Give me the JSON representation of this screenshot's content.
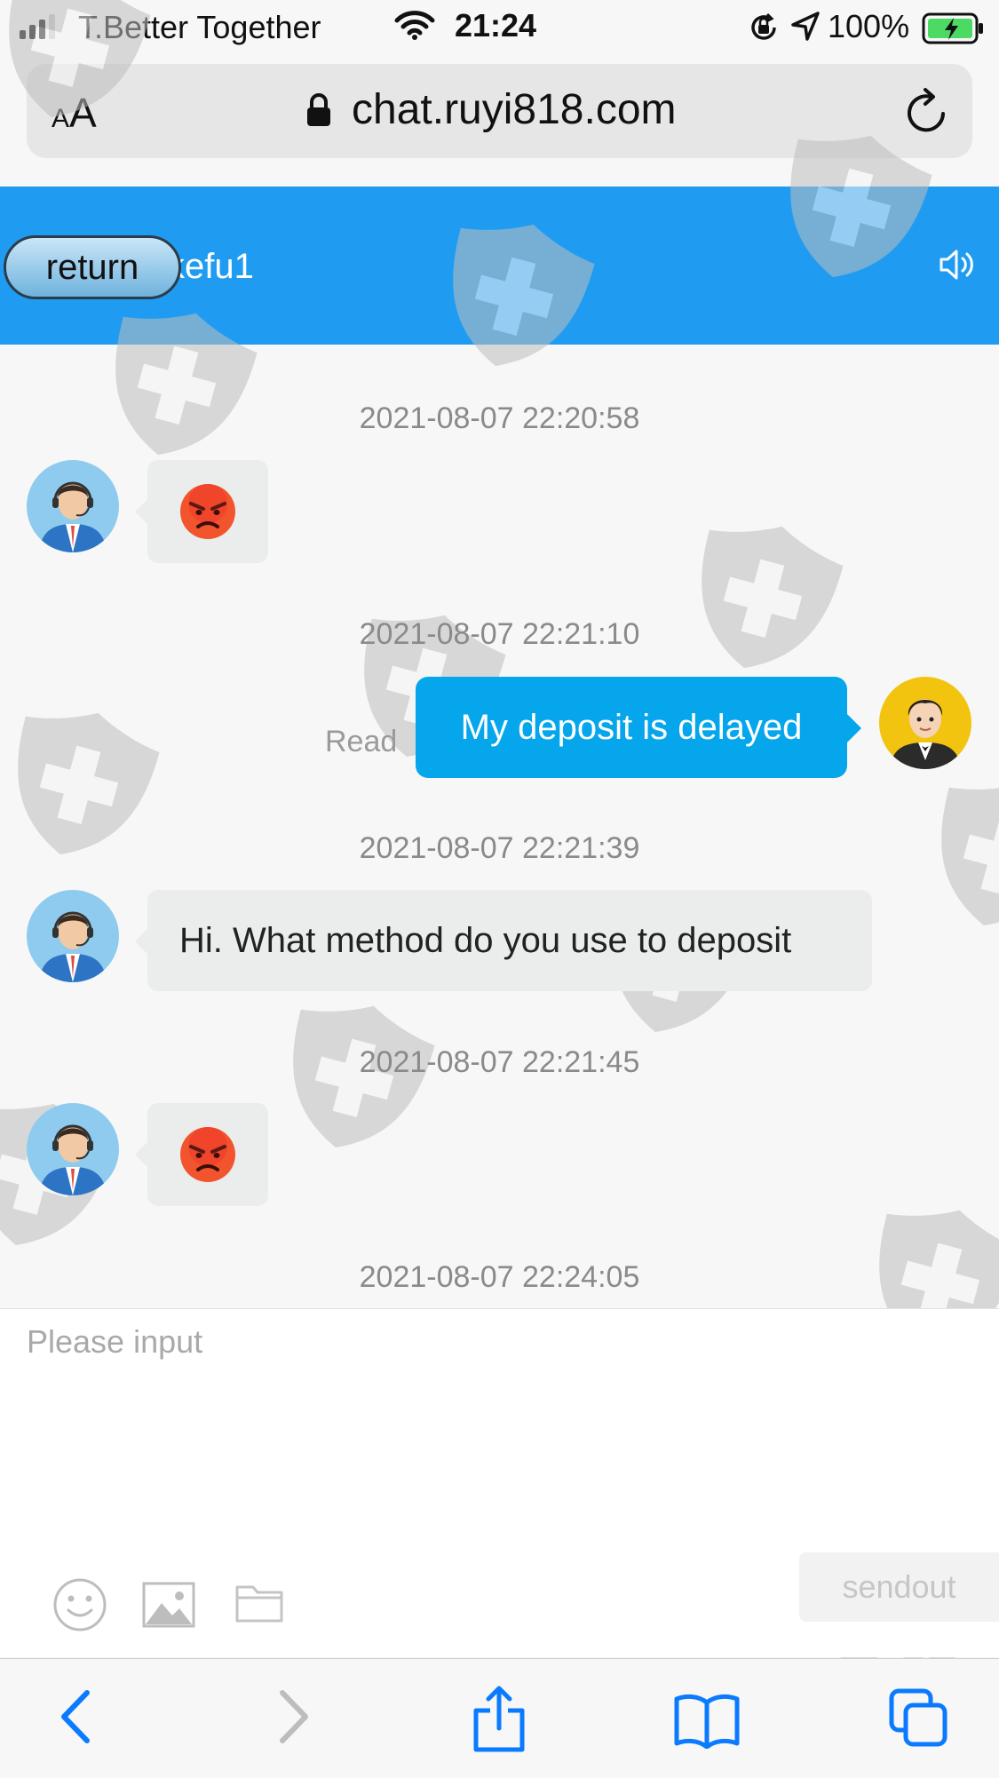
{
  "status_bar": {
    "carrier": "T.Better Together",
    "time": "21:24",
    "battery": "100%"
  },
  "browser": {
    "text_size_label": "AA",
    "url": "chat.ruyi818.com"
  },
  "header": {
    "return_label": "return",
    "title": "kefu1",
    "accent_color": "#1f9cf2"
  },
  "messages": [
    {
      "time": "2021-08-07 22:20:58",
      "side": "left",
      "type": "emoji",
      "content": "angry-face-emoji"
    },
    {
      "time": "2021-08-07 22:21:10",
      "side": "right",
      "type": "text",
      "content": "My deposit is delayed",
      "status": "Read"
    },
    {
      "time": "2021-08-07 22:21:39",
      "side": "left",
      "type": "text",
      "content": "Hi. What method do you use to deposit"
    },
    {
      "time": "2021-08-07 22:21:45",
      "side": "left",
      "type": "emoji",
      "content": "angry-face-emoji"
    },
    {
      "time": "2021-08-07 22:24:05"
    }
  ],
  "composer": {
    "placeholder": "Please input",
    "send_label": "sendout",
    "tools": [
      "smiley-icon",
      "image-icon",
      "folder-icon"
    ]
  },
  "toolbar": {
    "icons": [
      "back-icon",
      "forward-icon",
      "share-icon",
      "bookmarks-icon",
      "tabs-icon"
    ]
  }
}
